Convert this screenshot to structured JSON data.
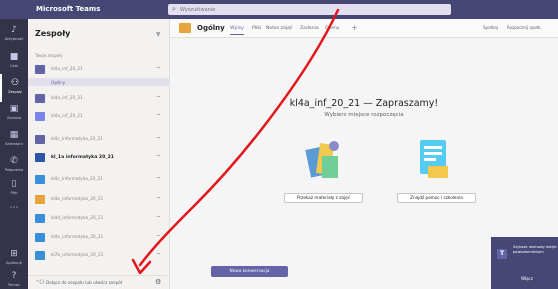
{
  "app": {
    "title": "Microsoft Teams"
  },
  "search": {
    "placeholder": "Wyszukiwanie"
  },
  "rail": [
    {
      "label": "Aktywność",
      "icon": "bell-icon"
    },
    {
      "label": "Czat",
      "icon": "chat-icon"
    },
    {
      "label": "Zespoły",
      "icon": "teams-icon",
      "active": true
    },
    {
      "label": "Zadania",
      "icon": "assignments-icon"
    },
    {
      "label": "Kalendarz",
      "icon": "calendar-icon"
    },
    {
      "label": "Połączenia",
      "icon": "phone-icon"
    },
    {
      "label": "Pliki",
      "icon": "files-icon"
    },
    {
      "label": "",
      "icon": "more-icon"
    },
    {
      "label": "Aplikacje",
      "icon": "apps-icon"
    },
    {
      "label": "Pomoc",
      "icon": "help-icon"
    }
  ],
  "panel": {
    "title": "Zespoły",
    "section_label": "Twoje zespoły",
    "general_channel": "Ogólny",
    "teams": [
      {
        "name": "kl4a_inf_20_21",
        "color": "#6264a7"
      },
      {
        "name": "kl4a_inf_20_21",
        "color": "#6264a7"
      },
      {
        "name": "kl4a_inf_20_21",
        "color": "#7b83eb"
      },
      {
        "name": "kl4c_informatyka_20_21",
        "color": "#6264a7"
      },
      {
        "name": "kl_1a informatyka 20_21",
        "color": "#2e56a6",
        "bold": true
      },
      {
        "name": "kl4c_informatyka_20_21",
        "color": "#3a8ed8"
      },
      {
        "name": "kl4e_informatyka_20_21",
        "color": "#e8a33d"
      },
      {
        "name": "kl4d_informatyka_20_21",
        "color": "#3a8ed8"
      },
      {
        "name": "kl4e_informatyka_20_21",
        "color": "#3a8ed8"
      },
      {
        "name": "kl7b_informatyka_20_21",
        "color": "#3a8ed8"
      }
    ],
    "join_label": "Dołącz do zespołu lub utwórz zespół"
  },
  "main": {
    "channel_name": "Ogólny",
    "tabs": [
      "Wpisy",
      "Pliki",
      "Notes zajęć",
      "Zadania",
      "Oceny"
    ],
    "header_buttons": [
      "Spotkaj",
      "Rozpocznij spotk."
    ],
    "welcome_title": "kl4a_inf_20_21 — Zapraszamy!",
    "welcome_subtitle": "Wybierz miejsce rozpoczęcia",
    "action_upload": "Przekaż materiały z zajęć",
    "action_help": "Znajdź pomoc i szkolenia",
    "new_conversation": "Nowa konwersacja"
  },
  "toast": {
    "text": "Szybsze rozmowy dzięki powiadomieniom",
    "button": "Włącz"
  },
  "colors": {
    "brand": "#464775",
    "accent": "#6264a7",
    "annotation": "#e0181e"
  }
}
